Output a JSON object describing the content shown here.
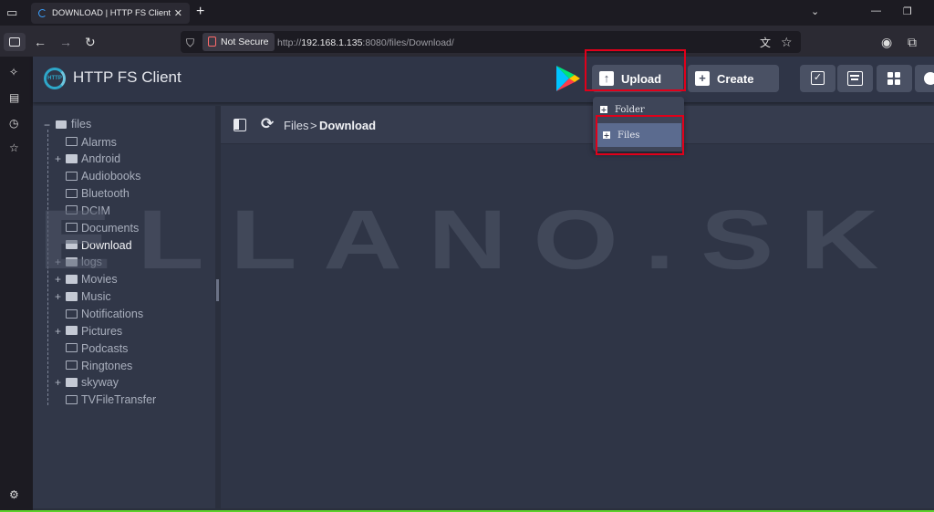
{
  "browser": {
    "tab_title": "DOWNLOAD | HTTP FS Client",
    "new_tab": "+",
    "security_label": "Not Secure",
    "url_scheme": "http://",
    "url_host": "192.168.1.135",
    "url_rest": ":8080/files/Download/"
  },
  "app": {
    "title": "HTTP FS Client",
    "logo_text": "HTTP",
    "upload_label": "Upload",
    "create_label": "Create"
  },
  "upload_menu": {
    "items": [
      {
        "label": "Folder"
      },
      {
        "label": "Files"
      }
    ]
  },
  "breadcrumb": {
    "root": "Files",
    "separator": ">",
    "current": "Download"
  },
  "tree": {
    "root": "files",
    "items": [
      {
        "label": "Alarms",
        "expandable": false,
        "filled": false
      },
      {
        "label": "Android",
        "expandable": true,
        "filled": true
      },
      {
        "label": "Audiobooks",
        "expandable": false,
        "filled": false
      },
      {
        "label": "Bluetooth",
        "expandable": false,
        "filled": false
      },
      {
        "label": "DCIM",
        "expandable": false,
        "filled": false
      },
      {
        "label": "Documents",
        "expandable": false,
        "filled": false
      },
      {
        "label": "Download",
        "expandable": false,
        "filled": true,
        "selected": true
      },
      {
        "label": "logs",
        "expandable": true,
        "filled": true
      },
      {
        "label": "Movies",
        "expandable": true,
        "filled": true
      },
      {
        "label": "Music",
        "expandable": true,
        "filled": true
      },
      {
        "label": "Notifications",
        "expandable": false,
        "filled": false
      },
      {
        "label": "Pictures",
        "expandable": true,
        "filled": true
      },
      {
        "label": "Podcasts",
        "expandable": false,
        "filled": false
      },
      {
        "label": "Ringtones",
        "expandable": false,
        "filled": false
      },
      {
        "label": "skyway",
        "expandable": true,
        "filled": true
      },
      {
        "label": "TVFileTransfer",
        "expandable": false,
        "filled": false
      }
    ]
  },
  "watermark": "ELLANO.SK",
  "colors": {
    "accent": "#2ea7c9",
    "highlight_red": "#e0001a",
    "selected_item": "#5b6b8f"
  }
}
